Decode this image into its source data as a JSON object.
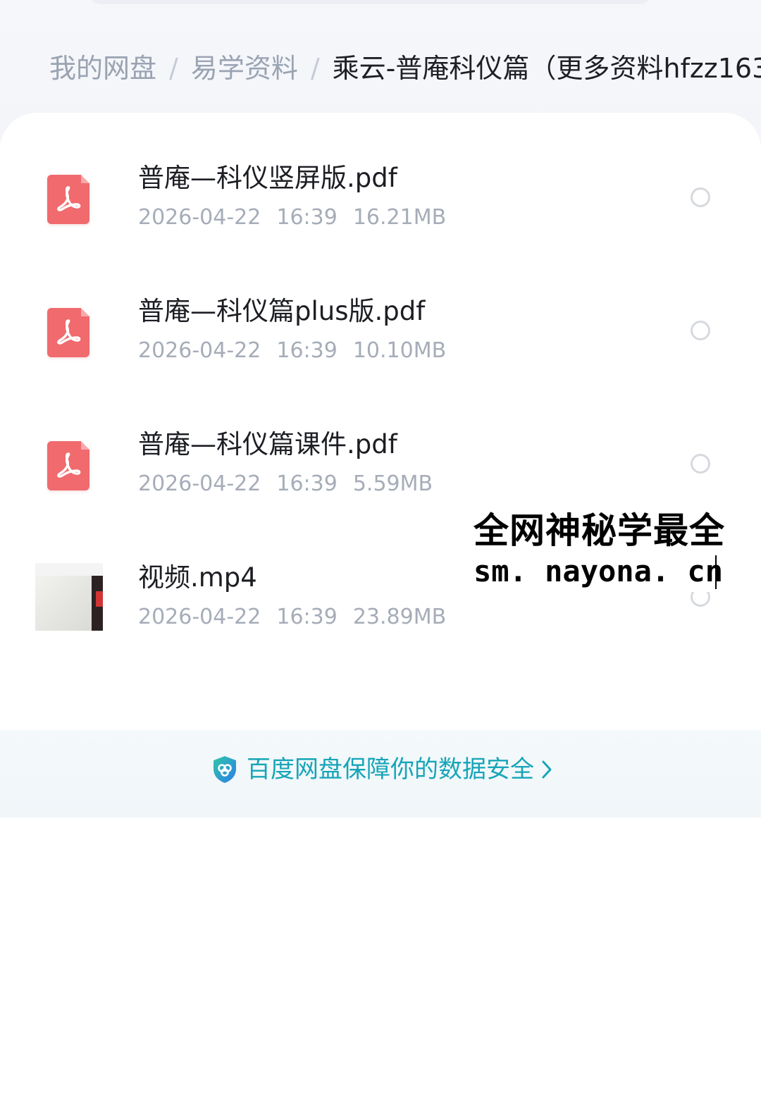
{
  "breadcrumb": {
    "items": [
      "我的网盘",
      "易学资料"
    ],
    "separator": "/",
    "current": "乘云-普庵科仪篇（更多资料hfzz163"
  },
  "files": [
    {
      "name": "普庵—科仪竖屏版.pdf",
      "date": "2026-04-22",
      "time": "16:39",
      "size": "16.21MB",
      "icon": "pdf-icon"
    },
    {
      "name": "普庵—科仪篇plus版.pdf",
      "date": "2026-04-22",
      "time": "16:39",
      "size": "10.10MB",
      "icon": "pdf-icon"
    },
    {
      "name": "普庵—科仪篇课件.pdf",
      "date": "2026-04-22",
      "time": "16:39",
      "size": "5.59MB",
      "icon": "pdf-icon"
    },
    {
      "name": "视频.mp4",
      "date": "2026-04-22",
      "time": "16:39",
      "size": "23.89MB",
      "icon": "video-thumbnail"
    }
  ],
  "watermark": {
    "line1": "全网神秘学最全",
    "line2": "sm. nayona. cn"
  },
  "security": {
    "text": "百度网盘保障你的数据安全",
    "icon": "shield-icon",
    "arrow": "chevron-right-icon"
  },
  "colors": {
    "pdf": "#f06a6e",
    "security_link": "#16a5b8",
    "meta_text": "#a6adb8",
    "breadcrumb_inactive": "#9aa3b2"
  }
}
